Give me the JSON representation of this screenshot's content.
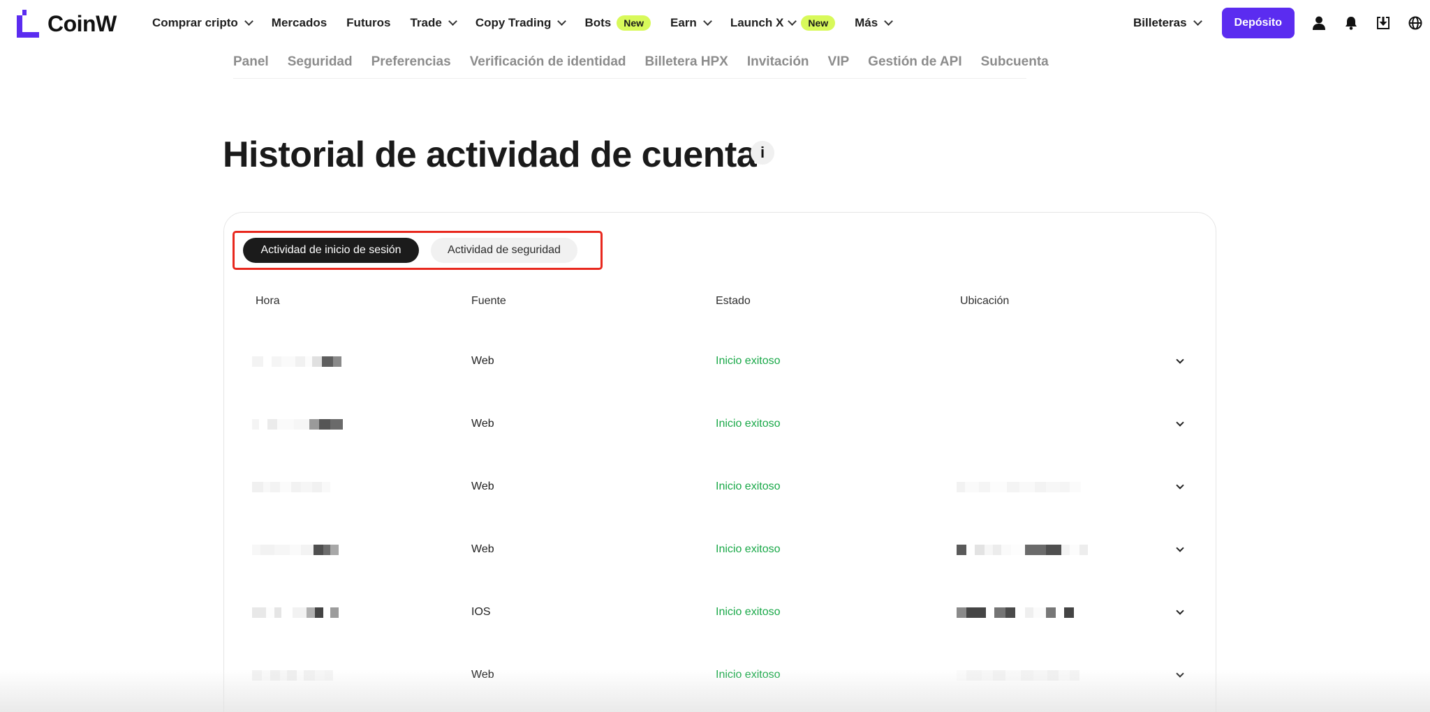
{
  "brand": {
    "name": "CoinW",
    "accent": "#5b2cf0"
  },
  "topnav": {
    "items": [
      {
        "label": "Comprar cripto",
        "dropdown": true
      },
      {
        "label": "Mercados"
      },
      {
        "label": "Futuros"
      },
      {
        "label": "Trade",
        "dropdown": true
      },
      {
        "label": "Copy Trading",
        "dropdown": true
      },
      {
        "label": "Bots",
        "badge": "New"
      },
      {
        "label": "Earn",
        "dropdown": true
      },
      {
        "label": "Launch X",
        "dropdown": true,
        "badge": "New"
      },
      {
        "label": "Más",
        "dropdown": true
      }
    ],
    "wallets_label": "Billeteras",
    "deposit_label": "Depósito",
    "icons": [
      "user-icon",
      "bell-icon",
      "download-icon",
      "globe-icon"
    ]
  },
  "subnav": {
    "items": [
      "Panel",
      "Seguridad",
      "Preferencias",
      "Verificación de identidad",
      "Billetera HPX",
      "Invitación",
      "VIP",
      "Gestión de API",
      "Subcuenta"
    ]
  },
  "page": {
    "title": "Historial de actividad de cuenta",
    "info_glyph": "i"
  },
  "tabs": {
    "active": "Actividad de inicio de sesión",
    "inactive": "Actividad de seguridad"
  },
  "table": {
    "headers": {
      "time": "Hora",
      "source": "Fuente",
      "status": "Estado",
      "location": "Ubicación"
    },
    "rows": [
      {
        "source": "Web",
        "status": "Inicio exitoso"
      },
      {
        "source": "Web",
        "status": "Inicio exitoso"
      },
      {
        "source": "Web",
        "status": "Inicio exitoso"
      },
      {
        "source": "Web",
        "status": "Inicio exitoso"
      },
      {
        "source": "IOS",
        "status": "Inicio exitoso"
      },
      {
        "source": "Web",
        "status": "Inicio exitoso"
      }
    ]
  },
  "colors": {
    "status_success": "#19a848",
    "highlight_border": "#e8281e",
    "new_badge": "#d8f95a"
  }
}
